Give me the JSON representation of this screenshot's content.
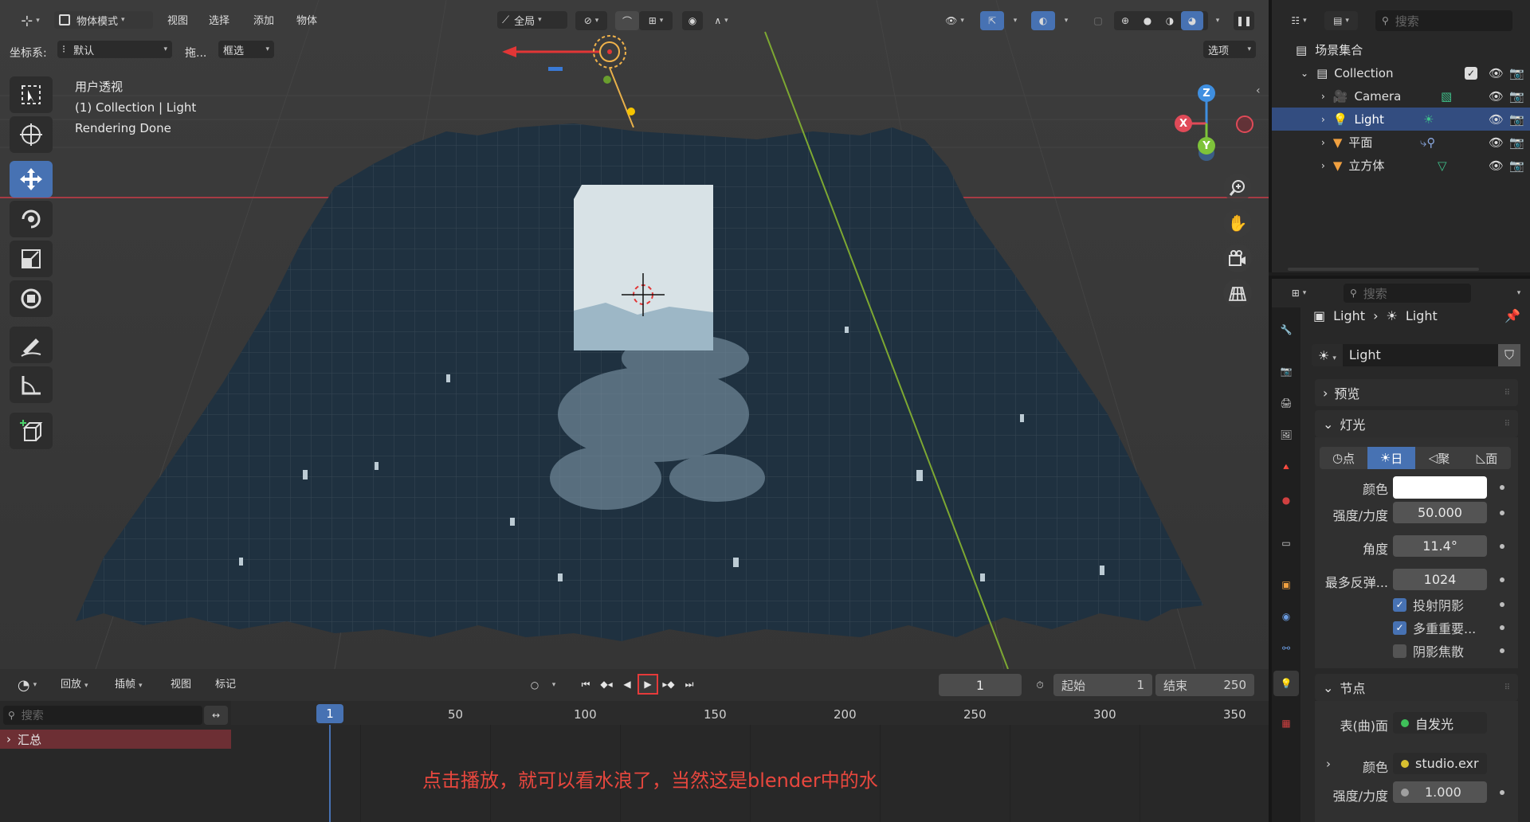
{
  "header": {
    "mode_label": "物体模式",
    "menu": [
      "视图",
      "选择",
      "添加",
      "物体"
    ],
    "transform_space": "全局",
    "coord_label": "坐标系:",
    "coord_value": "默认",
    "drag_label": "拖...",
    "select_mode": "框选",
    "options_label": "选项"
  },
  "viewport": {
    "overlay_lines": [
      "用户透视",
      "(1) Collection | Light",
      "Rendering Done"
    ],
    "axis_labels": {
      "x": "X",
      "y": "Y",
      "z": "Z"
    },
    "tools": [
      "select-box",
      "cursor",
      "move",
      "rotate",
      "scale",
      "transform",
      "annotate",
      "measure",
      "add-cube"
    ],
    "active_tool": "move",
    "colors": {
      "water": "#1f3140",
      "bg": "#3d3d3d",
      "cube": "#d8e2e6",
      "red_axis": "#d4404e",
      "green_axis": "#8fc23a"
    }
  },
  "outliner": {
    "search_placeholder": "搜索",
    "root": "场景集合",
    "items": [
      {
        "name": "Collection",
        "level": 0
      },
      {
        "name": "Camera",
        "level": 1
      },
      {
        "name": "Light",
        "level": 1,
        "selected": true
      },
      {
        "name": "平面",
        "level": 1
      },
      {
        "name": "立方体",
        "level": 1
      }
    ]
  },
  "properties": {
    "search_placeholder": "搜索",
    "breadcrumb": [
      "Light",
      "Light"
    ],
    "datablock": "Light",
    "panels": {
      "preview": "预览",
      "light": "灯光",
      "nodes": "节点"
    },
    "light_types": [
      "点",
      "日",
      "聚",
      "面"
    ],
    "active_light_type": "日",
    "fields": {
      "color_label": "颜色",
      "strength_label": "强度/力度",
      "strength_value": "50.000",
      "angle_label": "角度",
      "angle_value": "11.4°",
      "bounces_label": "最多反弹...",
      "bounces_value": "1024"
    },
    "checkboxes": [
      {
        "label": "投射阴影",
        "checked": true
      },
      {
        "label": "多重重要...",
        "checked": true
      },
      {
        "label": "阴影焦散",
        "checked": false
      }
    ],
    "nodes": {
      "surface_label": "表(曲)面",
      "surface_value": "自发光",
      "color_label": "颜色",
      "color_value": "studio.exr",
      "strength_label": "强度/力度",
      "strength_value": "1.000"
    }
  },
  "timeline": {
    "menu": [
      "回放",
      "插帧",
      "视图",
      "标记"
    ],
    "current_frame": "1",
    "start_label": "起始",
    "start_value": "1",
    "end_label": "结束",
    "end_value": "250",
    "search_placeholder": "搜索",
    "summary": "汇总",
    "ruler": [
      "50",
      "100",
      "150",
      "200",
      "250",
      "300",
      "350"
    ],
    "playhead": "1",
    "annotation": "点击播放，就可以看水浪了，当然这是blender中的水"
  }
}
